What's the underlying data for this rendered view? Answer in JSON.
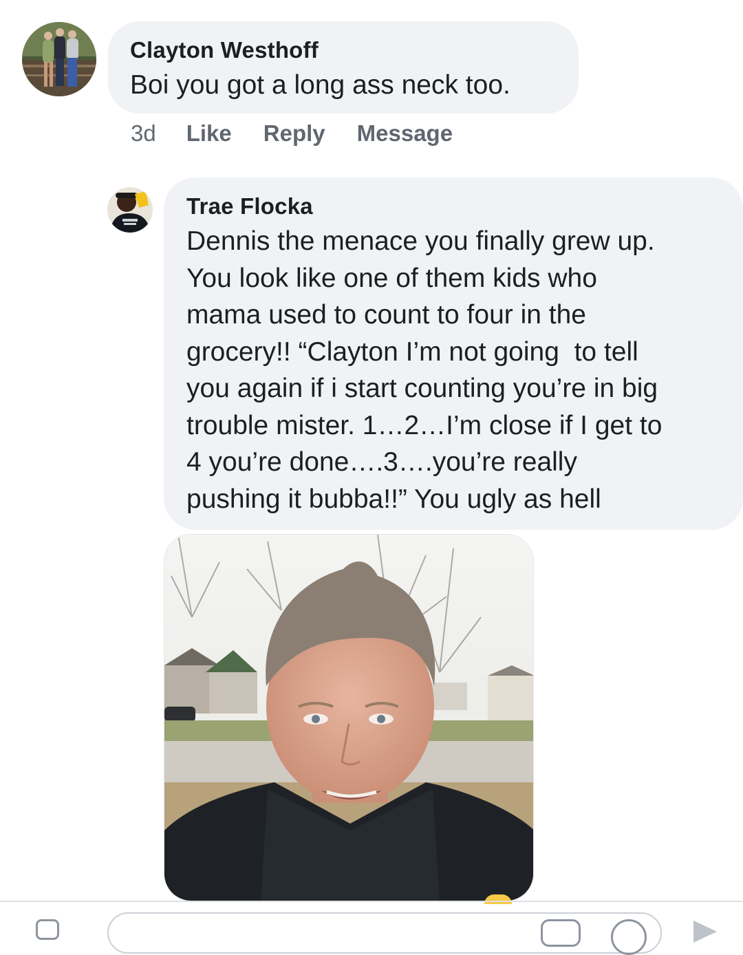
{
  "comment_1": {
    "author": "Clayton Westhoff",
    "text": "Boi you got a long ass neck too.",
    "time": "3d",
    "actions": {
      "like": "Like",
      "reply": "Reply",
      "message": "Message"
    }
  },
  "reply_1": {
    "author": "Trae Flocka",
    "lines": [
      "Dennis the menace you finally grew up.",
      "You look like one of them kids who",
      "mama used to count to four in the",
      "grocery!! “Clayton I’m not going  to tell",
      "you again if i start counting you’re in big",
      "trouble mister. 1…2…I’m close if I get to",
      "4 you’re done….3….you’re really",
      "pushing it bubba!!” You ugly as hell"
    ]
  },
  "colors": {
    "bubble": "#f0f2f5",
    "secondary_text": "#606770",
    "primary_text": "#1c1e21",
    "divider": "#dddfe2"
  },
  "icons": {
    "composer_left": "camera-icon",
    "composer_sticker": "sticker-icon",
    "composer_emoji": "emoji-icon",
    "composer_send": "send-icon"
  }
}
